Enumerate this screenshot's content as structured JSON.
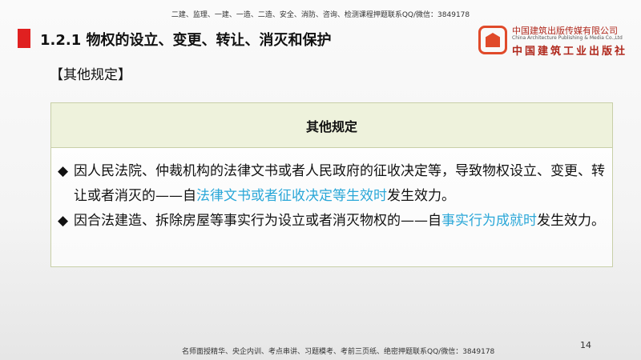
{
  "header_note": "二建、监理、一建、一造、二造、安全、消防、咨询、检测课程押题联系QQ/微信：3849178",
  "title": "1.2.1  物权的设立、变更、转让、消灭和保护",
  "logo": {
    "cn": "中国建筑出版传媒有限公司",
    "en": "China Architecture Publishing & Media Co.,Ltd",
    "cn2": "中国建筑工业出版社"
  },
  "subtitle": "【其他规定】",
  "box": {
    "heading": "其他规定",
    "items": [
      {
        "bullet": "◆",
        "pre": "因人民法院、仲裁机构的法律文书或者人民政府的征收决定等，导致物权设立、变更、转让或者消灭的——自",
        "highlight": "法律文书或者征收决定等生效时",
        "post": "发生效力。"
      },
      {
        "bullet": "◆",
        "pre": "因合法建造、拆除房屋等事实行为设立或者消灭物权的——自",
        "highlight": "事实行为成就时",
        "post": "发生效力。"
      }
    ]
  },
  "footer_note": "名师面授精华、央企内训、考点串讲、习题模考、考前三页纸、绝密押题联系QQ/微信：3849178",
  "page_number": "14",
  "colors": {
    "accent": "#e02020",
    "highlight": "#2aa7d8",
    "header_band": "#eef2dc"
  }
}
